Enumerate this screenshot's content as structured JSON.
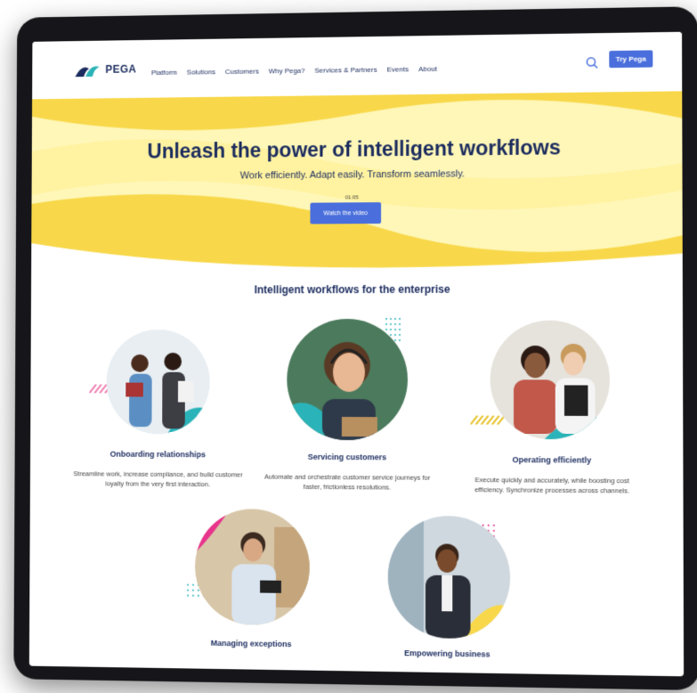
{
  "brand": {
    "name": "PEGA"
  },
  "nav": {
    "items": [
      "Platform",
      "Solutions",
      "Customers",
      "Why Pega?",
      "Services & Partners",
      "Events",
      "About"
    ],
    "cta": "Try Pega"
  },
  "hero": {
    "title": "Unleash the power of intelligent workflows",
    "subtitle": "Work efficiently. Adapt easily. Transform seamlessly.",
    "duration": "01:05",
    "button": "Watch the video"
  },
  "section": {
    "title": "Intelligent workflows for the enterprise",
    "cards": [
      {
        "title": "Onboarding relationships",
        "desc": "Streamline work, increase compliance, and build customer loyalty from the very first interaction."
      },
      {
        "title": "Servicing customers",
        "desc": "Automate and orchestrate customer service journeys for faster, frictionless resolutions."
      },
      {
        "title": "Operating efficiently",
        "desc": "Execute quickly and accurately, while boosting cost efficiency. Synchronize processes across channels."
      },
      {
        "title": "Managing exceptions",
        "desc": ""
      },
      {
        "title": "Empowering business",
        "desc": ""
      }
    ]
  },
  "colors": {
    "navy": "#1a2b5e",
    "accent": "#4a6fdc",
    "yellow": "#f8d84a",
    "teal": "#2ab3b8",
    "pink": "#e8348c"
  }
}
